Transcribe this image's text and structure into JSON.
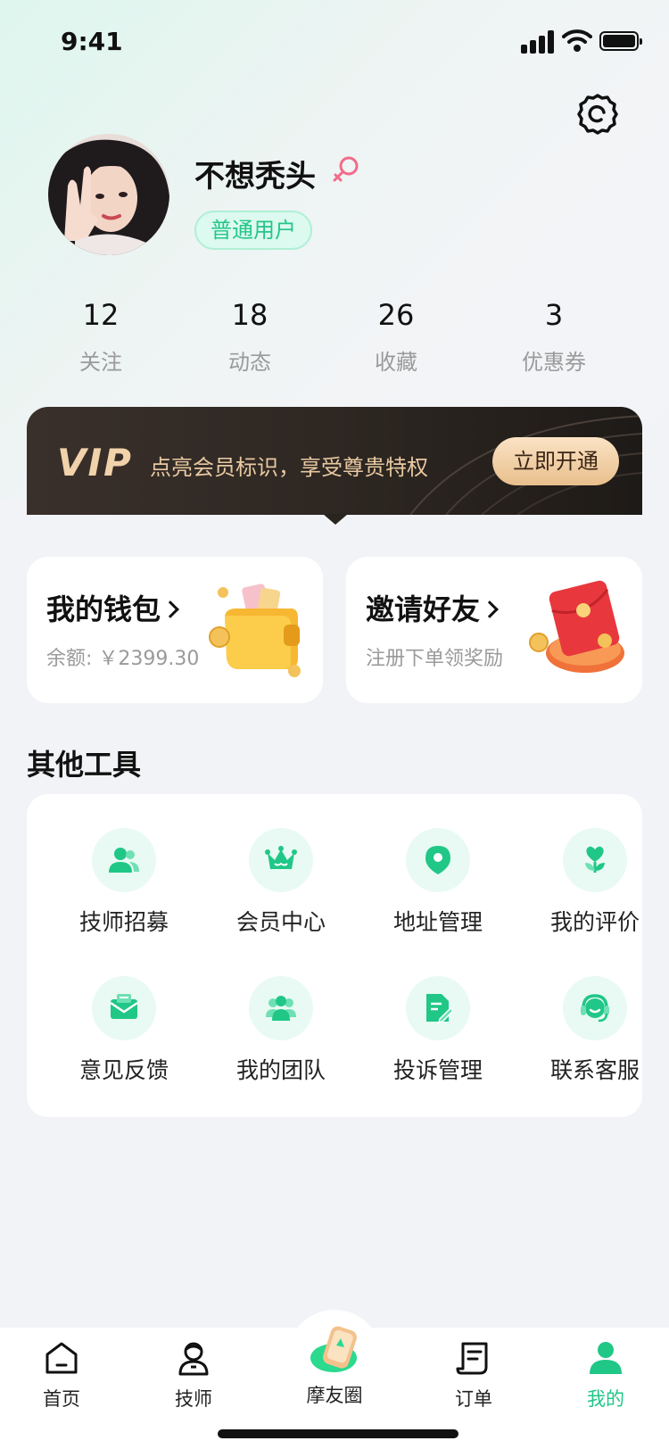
{
  "status_bar": {
    "time": "9:41"
  },
  "profile": {
    "username": "不想秃头",
    "user_type": "普通用户"
  },
  "stats": [
    {
      "value": "12",
      "label": "关注"
    },
    {
      "value": "18",
      "label": "动态"
    },
    {
      "value": "26",
      "label": "收藏"
    },
    {
      "value": "3",
      "label": "优惠券"
    }
  ],
  "vip": {
    "logo": "VIP",
    "text": "点亮会员标识，享受尊贵特权",
    "button": "立即开通"
  },
  "wallet": {
    "title": "我的钱包",
    "subtitle": "余额: ￥2399.30"
  },
  "invite": {
    "title": "邀请好友",
    "subtitle": "注册下单领奖励"
  },
  "tools": {
    "title": "其他工具",
    "items": [
      {
        "label": "技师招募",
        "icon": "users-icon"
      },
      {
        "label": "会员中心",
        "icon": "crown-icon"
      },
      {
        "label": "地址管理",
        "icon": "location-pin-icon"
      },
      {
        "label": "我的评价",
        "icon": "heart-flower-icon"
      },
      {
        "label": "意见反馈",
        "icon": "envelope-icon"
      },
      {
        "label": "我的团队",
        "icon": "team-icon"
      },
      {
        "label": "投诉管理",
        "icon": "document-edit-icon"
      },
      {
        "label": "联系客服",
        "icon": "headset-icon"
      }
    ]
  },
  "tabbar": {
    "items": [
      {
        "label": "首页",
        "icon": "home-icon"
      },
      {
        "label": "技师",
        "icon": "technician-icon"
      },
      {
        "label": "摩友圈",
        "icon": "moyouquan-icon"
      },
      {
        "label": "订单",
        "icon": "order-icon"
      },
      {
        "label": "我的",
        "icon": "profile-icon"
      }
    ],
    "active_index": 4
  },
  "colors": {
    "accent": "#20c787",
    "icon_bg": "#e8faf3",
    "vip_gold": "#e8c9a2",
    "page_bg": "#f2f3f7"
  }
}
